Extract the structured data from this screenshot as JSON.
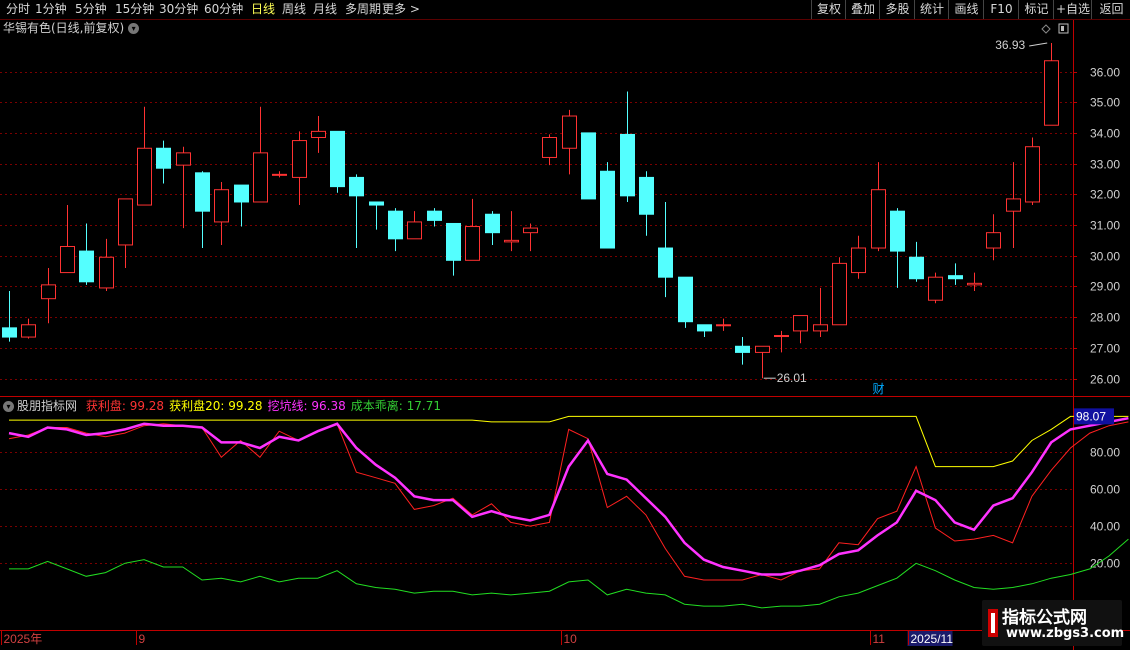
{
  "toolbar": {
    "periods": [
      "分时",
      "1分钟",
      "5分钟",
      "15分钟",
      "30分钟",
      "60分钟",
      "日线",
      "周线",
      "月线",
      "多周期",
      "更多 >"
    ],
    "active_period": "日线",
    "right_buttons": [
      "复权",
      "叠加",
      "多股",
      "统计",
      "画线",
      "F10",
      "标记",
      "+自选",
      "返回"
    ]
  },
  "stock": {
    "title": "华锡有色(日线,前复权)",
    "high_label": "36.93",
    "low_label": "26.01",
    "event_marker": "财"
  },
  "indicator": {
    "name": "股朋指标网",
    "items": [
      {
        "label": "获利盘: 99.28",
        "color": "#ff3333"
      },
      {
        "label": "获利盘20: 99.28",
        "color": "#ffff00"
      },
      {
        "label": "挖坑线: 96.38",
        "color": "#ff33ff"
      },
      {
        "label": "成本乖离: 17.71",
        "color": "#33cc33"
      }
    ],
    "current_value_label": "98.07",
    "axis_ticks": [
      20,
      40,
      60,
      80
    ]
  },
  "dates": {
    "labels": [
      {
        "text": "2025年",
        "idx": 0
      },
      {
        "text": "9",
        "idx": 7
      },
      {
        "text": "10",
        "idx": 29
      },
      {
        "text": "11",
        "idx": 45
      },
      {
        "text": "2025/11",
        "idx": 47
      }
    ]
  },
  "colors": {
    "up": "#ff3232",
    "down": "#54ffff",
    "grid": "#7a0000",
    "axis": "#c00000",
    "profit": "#ff2020",
    "profit20": "#ffff00",
    "dig": "#ff33ff",
    "bias": "#22dd22"
  },
  "chart_data": {
    "type": "candlestick",
    "price_axis_ticks": [
      26,
      27,
      28,
      29,
      30,
      31,
      32,
      33,
      34,
      35,
      36
    ],
    "candles": [
      [
        27.65,
        27.35,
        28.85,
        27.2
      ],
      [
        27.35,
        27.75,
        27.95,
        27.3
      ],
      [
        28.6,
        29.05,
        29.6,
        27.8
      ],
      [
        29.45,
        30.3,
        31.65,
        29.45
      ],
      [
        30.15,
        29.15,
        31.05,
        29.05
      ],
      [
        28.95,
        29.95,
        30.55,
        28.85
      ],
      [
        30.35,
        31.85,
        31.85,
        29.6
      ],
      [
        31.65,
        33.5,
        34.85,
        31.65
      ],
      [
        33.5,
        32.85,
        33.75,
        32.35
      ],
      [
        32.95,
        33.35,
        33.55,
        30.9
      ],
      [
        32.7,
        31.45,
        32.75,
        30.25
      ],
      [
        31.1,
        32.15,
        32.4,
        30.35
      ],
      [
        32.3,
        31.75,
        32.3,
        30.95
      ],
      [
        31.75,
        33.35,
        34.85,
        31.75
      ],
      [
        32.65,
        32.65,
        32.75,
        32.55
      ],
      [
        32.55,
        33.75,
        34.05,
        31.65
      ],
      [
        33.85,
        34.05,
        34.55,
        33.35
      ],
      [
        34.05,
        32.25,
        34.05,
        32.05
      ],
      [
        32.55,
        31.95,
        32.65,
        30.25
      ],
      [
        31.75,
        31.65,
        31.75,
        30.85
      ],
      [
        31.45,
        30.55,
        31.55,
        30.15
      ],
      [
        30.55,
        31.1,
        31.45,
        30.55
      ],
      [
        31.45,
        31.15,
        31.55,
        30.95
      ],
      [
        31.05,
        29.85,
        31.05,
        29.35
      ],
      [
        29.85,
        30.95,
        31.85,
        29.85
      ],
      [
        31.35,
        30.75,
        31.45,
        30.35
      ],
      [
        30.45,
        30.5,
        31.45,
        30.15
      ],
      [
        30.75,
        30.9,
        31.05,
        30.15
      ],
      [
        33.2,
        33.85,
        33.95,
        32.95
      ],
      [
        33.5,
        34.55,
        34.75,
        32.65
      ],
      [
        34.0,
        31.85,
        34.0,
        31.85
      ],
      [
        32.75,
        30.25,
        33.05,
        30.25
      ],
      [
        33.95,
        31.95,
        35.35,
        31.75
      ],
      [
        32.55,
        31.35,
        32.75,
        30.65
      ],
      [
        30.25,
        29.3,
        31.75,
        28.65
      ],
      [
        29.3,
        27.85,
        29.3,
        27.65
      ],
      [
        27.75,
        27.55,
        27.75,
        27.35
      ],
      [
        27.75,
        27.75,
        27.95,
        27.55
      ],
      [
        27.05,
        26.85,
        27.35,
        26.45
      ],
      [
        26.85,
        27.05,
        27.05,
        26.01
      ],
      [
        27.4,
        27.4,
        27.55,
        26.85
      ],
      [
        27.55,
        28.05,
        28.05,
        27.15
      ],
      [
        27.55,
        27.75,
        28.95,
        27.35
      ],
      [
        27.75,
        29.75,
        29.95,
        27.75
      ],
      [
        29.45,
        30.25,
        30.65,
        29.25
      ],
      [
        30.25,
        32.15,
        33.05,
        30.15
      ],
      [
        31.45,
        30.15,
        31.55,
        28.95
      ],
      [
        29.95,
        29.25,
        30.45,
        29.15
      ],
      [
        28.55,
        29.3,
        29.45,
        28.45
      ],
      [
        29.35,
        29.25,
        29.75,
        29.05
      ],
      [
        29.05,
        29.1,
        29.45,
        28.85
      ],
      [
        30.25,
        30.75,
        31.35,
        29.85
      ],
      [
        31.45,
        31.85,
        33.05,
        30.25
      ],
      [
        31.75,
        33.55,
        33.85,
        31.65
      ],
      [
        34.25,
        36.35,
        36.93,
        34.25
      ]
    ],
    "profit_series": [
      87,
      89,
      93,
      93,
      90,
      88,
      90,
      94,
      95,
      94,
      93,
      77,
      86,
      77,
      91,
      86,
      91,
      95,
      69,
      66,
      63,
      49,
      51,
      55,
      46,
      52,
      42,
      40,
      42,
      92,
      87,
      50,
      56,
      46,
      28,
      13,
      11,
      11,
      11,
      14,
      11,
      16,
      17,
      31,
      30,
      44,
      48,
      72,
      39,
      32,
      33,
      35,
      31,
      56,
      70,
      82,
      90,
      94,
      96
    ],
    "profit20_series": [
      97,
      97,
      97,
      97,
      97,
      97,
      97,
      97,
      97,
      97,
      97,
      97,
      97,
      97,
      97,
      97,
      97,
      97,
      97,
      97,
      97,
      97,
      97,
      97,
      97,
      96,
      96,
      96,
      96,
      99,
      99,
      99,
      99,
      99,
      99,
      99,
      99,
      99,
      99,
      99,
      99,
      99,
      99,
      99,
      99,
      99,
      99,
      99,
      72,
      72,
      72,
      72,
      75,
      86,
      92,
      99,
      99,
      99,
      99
    ],
    "dig_series": [
      90,
      88,
      93,
      92,
      89,
      90,
      92,
      95,
      94,
      94,
      93,
      85,
      85,
      82,
      88,
      86,
      91,
      95,
      82,
      73,
      66,
      56,
      54,
      54,
      45,
      48,
      45,
      43,
      46,
      72,
      86,
      68,
      65,
      55,
      45,
      31,
      22,
      18,
      16,
      14,
      14,
      16,
      19,
      25,
      27,
      35,
      42,
      59,
      54,
      42,
      38,
      51,
      55,
      69,
      85,
      92,
      94,
      96,
      98
    ],
    "bias_series": [
      17,
      17,
      21,
      17,
      13,
      15,
      20,
      22,
      18,
      18,
      11,
      12,
      10,
      13,
      10,
      12,
      12,
      16,
      9,
      7,
      6,
      4,
      5,
      5,
      3,
      4,
      3,
      4,
      5,
      10,
      11,
      3,
      6,
      4,
      3,
      -2,
      -3,
      -3,
      -2,
      -4,
      -3,
      -3,
      -2,
      2,
      4,
      8,
      12,
      20,
      16,
      11,
      7,
      6,
      7,
      9,
      12,
      14,
      17,
      24,
      33
    ]
  }
}
